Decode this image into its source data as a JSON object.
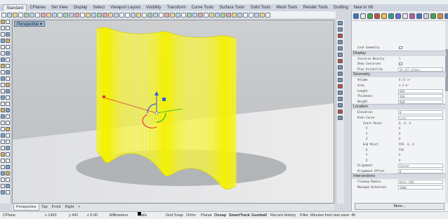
{
  "tabs": [
    "Standard",
    "CPlanes",
    "Set View",
    "Display",
    "Select",
    "Viewport Layout",
    "Visibility",
    "Transform",
    "Curve Tools",
    "Surface Tools",
    "Solid Tools",
    "Mesh Tools",
    "Render Tools",
    "Drafting",
    "New in V6"
  ],
  "viewport": {
    "title": "Perspective"
  },
  "view_tabs": [
    "Perspective",
    "Top",
    "Front",
    "Right"
  ],
  "view_tabs_add": "+",
  "properties": {
    "locked_geometry_label": "Lock Geometry",
    "display": {
      "header": "Display",
      "rows": [
        {
          "label": "Isocurve Density",
          "value": "1"
        },
        {
          "label": "Show Isocurves",
          "value": ""
        },
        {
          "label": "Plan Visibility",
          "value": "In all plans"
        }
      ]
    },
    "geometry": {
      "header": "Geometry",
      "rows": [
        {
          "label": "Volume",
          "value": "0.52 m³"
        },
        {
          "label": "Area",
          "value": "4.4 m²"
        },
        {
          "label": "Length",
          "value": "999"
        },
        {
          "label": "Thickness",
          "value": "100"
        },
        {
          "label": "Height",
          "value": "900"
        }
      ]
    },
    "location": {
      "header": "Location",
      "rows": [
        {
          "label": "Elevation",
          "value": "0"
        },
        {
          "label": "Path Curve",
          "value": "Line"
        },
        {
          "label": "Start Point",
          "value": "0, 0, 0"
        },
        {
          "label": "X",
          "value": "0"
        },
        {
          "label": "Y",
          "value": "0"
        },
        {
          "label": "Z",
          "value": "0"
        },
        {
          "label": "End Point",
          "value": "999, 0, 0"
        },
        {
          "label": "X",
          "value": "999"
        },
        {
          "label": "Y",
          "value": "0"
        },
        {
          "label": "Z",
          "value": "0"
        },
        {
          "label": "Alignment",
          "value": "Center"
        },
        {
          "label": "Alignment Offset",
          "value": "0"
        }
      ]
    },
    "intersections": {
      "header": "Intersections",
      "rows": [
        {
          "label": "Cleanup Radius",
          "value": "Auto (60)"
        },
        {
          "label": "Maximum Extension",
          "value": "1000"
        }
      ]
    },
    "more_button": "More..."
  },
  "status": {
    "cplane": "CPlane",
    "x": "x 1493",
    "y": "y 441",
    "z": "z 0.00",
    "units": "Millimeters",
    "layer": "Walls",
    "toggles": [
      "Grid Snap",
      "Ortho",
      "Planar",
      "Osnap",
      "SmartTrack",
      "Gumball",
      "Record History"
    ],
    "bold_toggles": [
      "Osnap",
      "SmartTrack",
      "Gumball"
    ],
    "filter": "Filter",
    "message": "Minutes from last save: 45"
  },
  "colors": {
    "wall_wire": "#f4f100",
    "wall_face": "#fbfba6",
    "gumball_x": "#e23a3a",
    "gumball_y": "#2fae2f",
    "gumball_z": "#2f5fe0",
    "viewport_bg": "#c9cbcd",
    "shadow": "#a4a7aa"
  },
  "icons": [
    "new-icon",
    "open-icon",
    "save-icon",
    "print-icon",
    "cut-icon",
    "copy-icon",
    "paste-icon",
    "undo-icon",
    "pan-icon",
    "rotate-view-icon",
    "zoom-icon",
    "zoom-window-icon",
    "zoom-extents-icon",
    "select-icon",
    "show-icon",
    "hide-icon",
    "lock-icon",
    "layer-icon",
    "render-icon",
    "material-icon",
    "options-icon",
    "help-icon"
  ]
}
